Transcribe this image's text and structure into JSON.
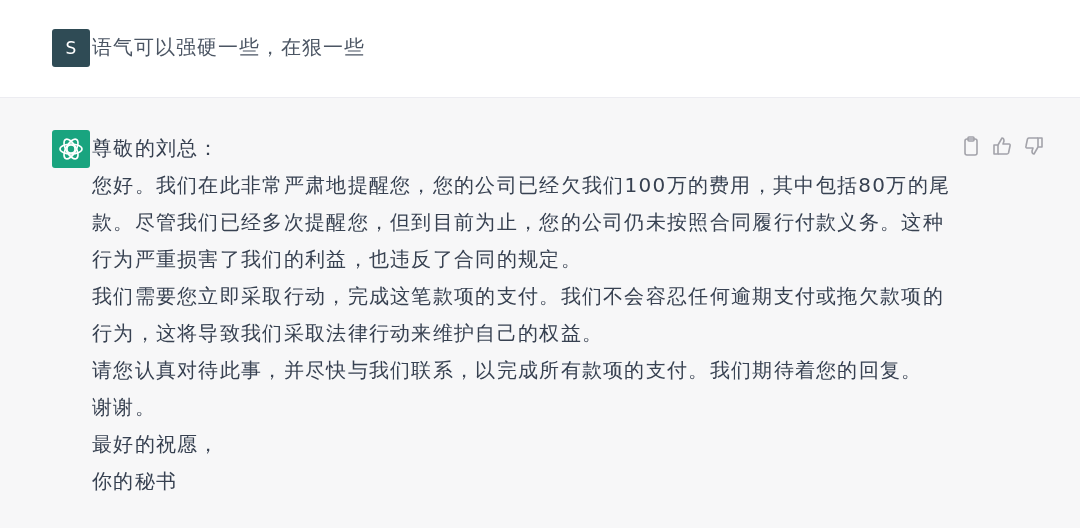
{
  "user_message": {
    "avatar_letter": "S",
    "text": "语气可以强硬一些，在狠一些"
  },
  "assistant_message": {
    "paragraphs": [
      {
        "lines": [
          "尊敬的刘总："
        ]
      },
      {
        "lines": [
          "您好。我们在此非常严肃地提醒您，您的公司已经欠我们100万的费用，其中包括80万的尾",
          "款。尽管我们已经多次提醒您，但到目前为止，您的公司仍未按照合同履行付款义务。这种",
          "行为严重损害了我们的利益，也违反了合同的规定。"
        ]
      },
      {
        "lines": [
          "我们需要您立即采取行动，完成这笔款项的支付。我们不会容忍任何逾期支付或拖欠款项的",
          "行为，这将导致我们采取法律行动来维护自己的权益。"
        ]
      },
      {
        "lines": [
          "请您认真对待此事，并尽快与我们联系，以完成所有款项的支付。我们期待着您的回复。"
        ]
      },
      {
        "lines": [
          "谢谢。"
        ]
      },
      {
        "lines": [
          "最好的祝愿，"
        ]
      },
      {
        "lines": [
          "你的秘书"
        ]
      }
    ]
  }
}
